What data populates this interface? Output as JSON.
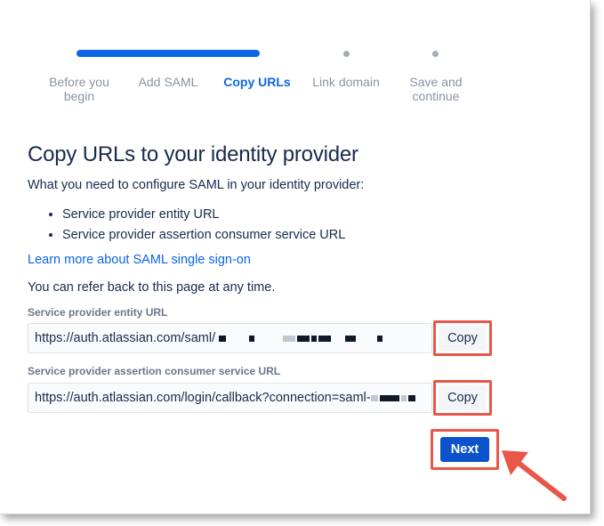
{
  "stepper": {
    "steps": [
      {
        "label": "Before you begin",
        "state": "done"
      },
      {
        "label": "Add SAML",
        "state": "done"
      },
      {
        "label": "Copy URLs",
        "state": "current"
      },
      {
        "label": "Link domain",
        "state": "upcoming"
      },
      {
        "label": "Save and continue",
        "state": "upcoming"
      }
    ]
  },
  "content": {
    "title": "Copy URLs to your identity provider",
    "intro": "What you need to configure SAML in your identity provider:",
    "requirements": [
      "Service provider entity URL",
      "Service provider assertion consumer service URL"
    ],
    "learn_more_link": "Learn more about SAML single sign-on",
    "refer_back": "You can refer back to this page at any time."
  },
  "fields": {
    "entity_url": {
      "label": "Service provider entity URL",
      "value": "https://auth.atlassian.com/saml/",
      "copy_label": "Copy"
    },
    "acs_url": {
      "label": "Service provider assertion consumer service URL",
      "value": "https://auth.atlassian.com/login/callback?connection=saml-",
      "copy_label": "Copy"
    }
  },
  "actions": {
    "next_label": "Next"
  },
  "colors": {
    "accent": "#0c66e4",
    "primary_button": "#0c52cc",
    "annotation": "#e8574a",
    "muted": "#8993a4"
  }
}
